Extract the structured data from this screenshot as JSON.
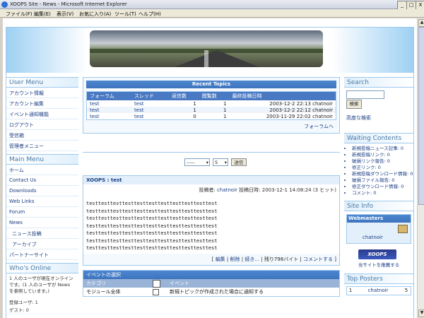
{
  "window": {
    "title": "XOOPS Site - News - Microsoft Internet Explorer",
    "minimize": "_",
    "maximize": "□",
    "close": "X"
  },
  "menubar": [
    "ファイル(F)",
    "編集(E)",
    "表示(V)",
    "お気に入り(A)",
    "ツール(T)",
    "ヘルプ(H)"
  ],
  "user_menu": {
    "title": "User Menu",
    "items": [
      "アカウント情報",
      "アカウント編集",
      "イベント通知機能",
      "ログアウト",
      "受信箱",
      "管理者メニュー"
    ]
  },
  "main_menu": {
    "title": "Main Menu",
    "items": [
      "ホーム",
      "Contact Us",
      "Downloads",
      "Web Links",
      "Forum",
      "News"
    ],
    "sub_items": [
      "ニュース投稿",
      "アーカイブ"
    ],
    "last_item": "パートナーサイト"
  },
  "whos_online": {
    "title": "Who's Online",
    "text": "1 人のユーザが現在オンラインです。(1 人のユーザが News を参照しています。)",
    "members": "登録ユーザ: 1",
    "guests": "ゲスト: 0"
  },
  "recent_topics": {
    "title": "Recent Topics",
    "headers": [
      "フォーラム",
      "スレッド",
      "返信数",
      "閲覧数",
      "最終投稿日時"
    ],
    "rows": [
      {
        "forum": "test",
        "thread": "test",
        "replies": "1",
        "views": "1",
        "last": "2003-12-2 22:13 chatnoir"
      },
      {
        "forum": "test",
        "thread": "test",
        "replies": "1",
        "views": "1",
        "last": "2003-12-2 22:12 chatnoir"
      },
      {
        "forum": "test",
        "thread": "test",
        "replies": "0",
        "views": "1",
        "last": "2003-11-29 22:02 chatnoir"
      }
    ],
    "more": "フォーラムへ"
  },
  "pager": {
    "select1": "-----",
    "select2": "5",
    "go": "送信"
  },
  "article": {
    "title": "XOOPS : test",
    "poster_label": "投稿者:",
    "poster": "chatnoir",
    "date_label": "投稿日時: 2003-12-1 14:08:24 (3 ヒット)",
    "body": [
      "testtesttesttesttesttesttesttesttesttesttest",
      "testtesttesttesttesttesttesttesttesttesttest",
      "testtesttesttesttesttesttesttesttesttesttest",
      "testtesttesttesttesttesttesttesttesttesttest",
      "testtesttesttesttesttesttesttesttesttesttest",
      "testtesttesttesttesttesttesttesttesttesttest",
      "testtesttesttesttesttesttesttesttesttesttest"
    ],
    "footer_prefix": "[",
    "edit": "編集",
    "sep1": "|",
    "delete": "削除",
    "sep2": "|",
    "more": "続き...",
    "rest": "| 残り798バイト |",
    "comment": "コメントする",
    "footer_suffix": "]"
  },
  "events": {
    "title": "イベントの選択",
    "cat_header": "カテゴリ",
    "event_header": "イベント",
    "row_label": "モジュール全体",
    "row_event": "新規トピックが作成された場合に通知する"
  },
  "search": {
    "title": "Search",
    "button": "検索",
    "advanced": "高度な検索"
  },
  "waiting": {
    "title": "Waiting Contents",
    "items": [
      "新規投稿ニュース記事: 0",
      "新規投稿リンク: 0",
      "破損リンク報告: 0",
      "修正リンク: 0",
      "新規投稿ダウンロード情報: 0",
      "破損ファイル報告: 0",
      "修正ダウンロード情報: 0",
      "コメント: 0"
    ]
  },
  "site_info": {
    "title": "Site Info",
    "webmasters": "Webmasters",
    "admin": "chatnoir",
    "logo": "XOOPS",
    "recommend": "当サイトを推薦する"
  },
  "top_posters": {
    "title": "Top Posters",
    "rank": "1",
    "name": "chatnoir",
    "count": "5"
  }
}
